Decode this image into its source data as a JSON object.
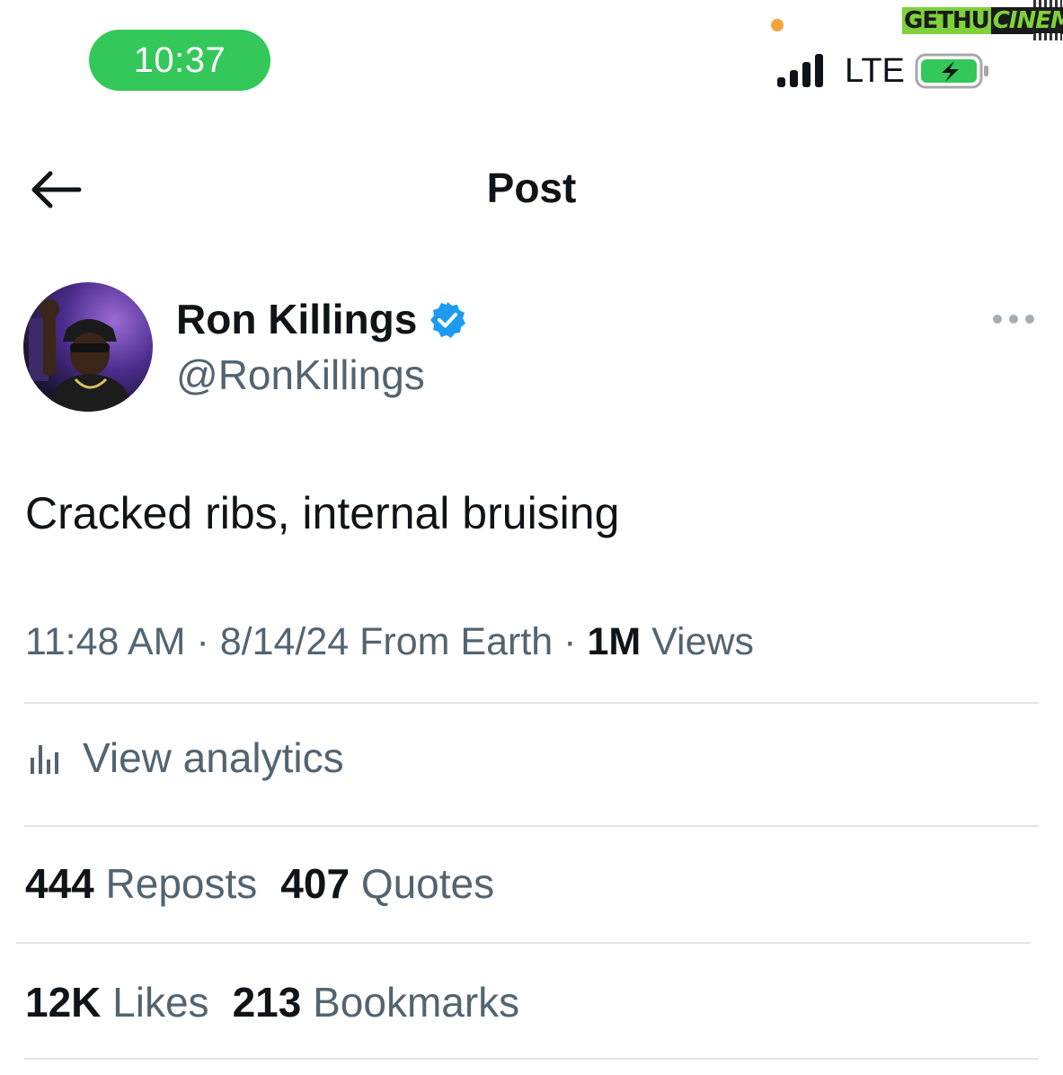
{
  "status_bar": {
    "time": "10:37",
    "network": "LTE",
    "accent_color": "#34c759"
  },
  "watermark": {
    "part1": "GETHU",
    "part2": "CINEMA"
  },
  "header": {
    "title": "Post",
    "back_icon": "arrow-left-icon"
  },
  "author": {
    "name": "Ron Killings",
    "handle": "@RonKillings",
    "verified_color": "#1d9bf0"
  },
  "post": {
    "text": "Cracked ribs, internal bruising",
    "time": "11:48 AM",
    "date": "8/14/24",
    "source": "From Earth",
    "views_count": "1M",
    "views_label": "Views"
  },
  "analytics": {
    "label": "View analytics",
    "icon": "bar-chart-icon"
  },
  "stats": {
    "reposts_count": "444",
    "reposts_label": "Reposts",
    "quotes_count": "407",
    "quotes_label": "Quotes",
    "likes_count": "12K",
    "likes_label": "Likes",
    "bookmarks_count": "213",
    "bookmarks_label": "Bookmarks"
  }
}
